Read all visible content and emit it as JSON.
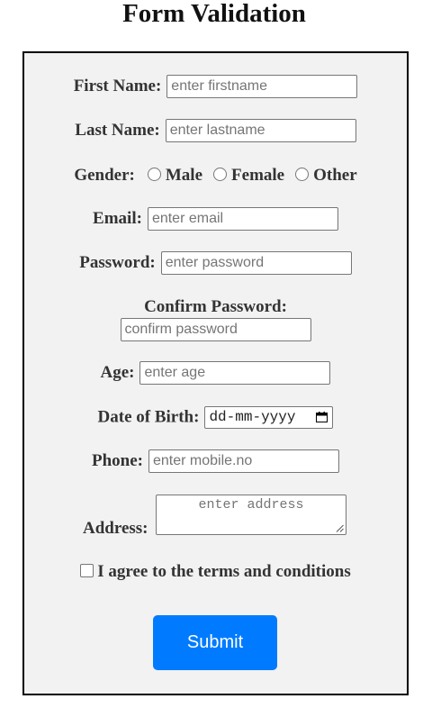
{
  "page": {
    "title": "Form Validation"
  },
  "form": {
    "first_name": {
      "label": "First Name:",
      "placeholder": "enter firstname"
    },
    "last_name": {
      "label": "Last Name:",
      "placeholder": "enter lastname"
    },
    "gender": {
      "label": "Gender:",
      "options": [
        "Male",
        "Female",
        "Other"
      ]
    },
    "email": {
      "label": "Email:",
      "placeholder": "enter email"
    },
    "password": {
      "label": "Password:",
      "placeholder": "enter password"
    },
    "confirm_password": {
      "label": "Confirm Password:",
      "placeholder": "confirm password"
    },
    "age": {
      "label": "Age:",
      "placeholder": "enter age"
    },
    "dob": {
      "label": "Date of Birth:",
      "value": "dd-mm-yyyy"
    },
    "phone": {
      "label": "Phone:",
      "placeholder": "enter mobile.no"
    },
    "address": {
      "label": "Address:",
      "placeholder": "enter address"
    },
    "terms": {
      "label": "I agree to the terms and conditions"
    },
    "submit_label": "Submit"
  },
  "colors": {
    "form_background": "#f2f2f2",
    "submit_background": "#007bff",
    "submit_text": "#ffffff"
  },
  "icons": {
    "date_picker": "calendar-icon",
    "textarea_resize": "resize-grip-icon"
  }
}
